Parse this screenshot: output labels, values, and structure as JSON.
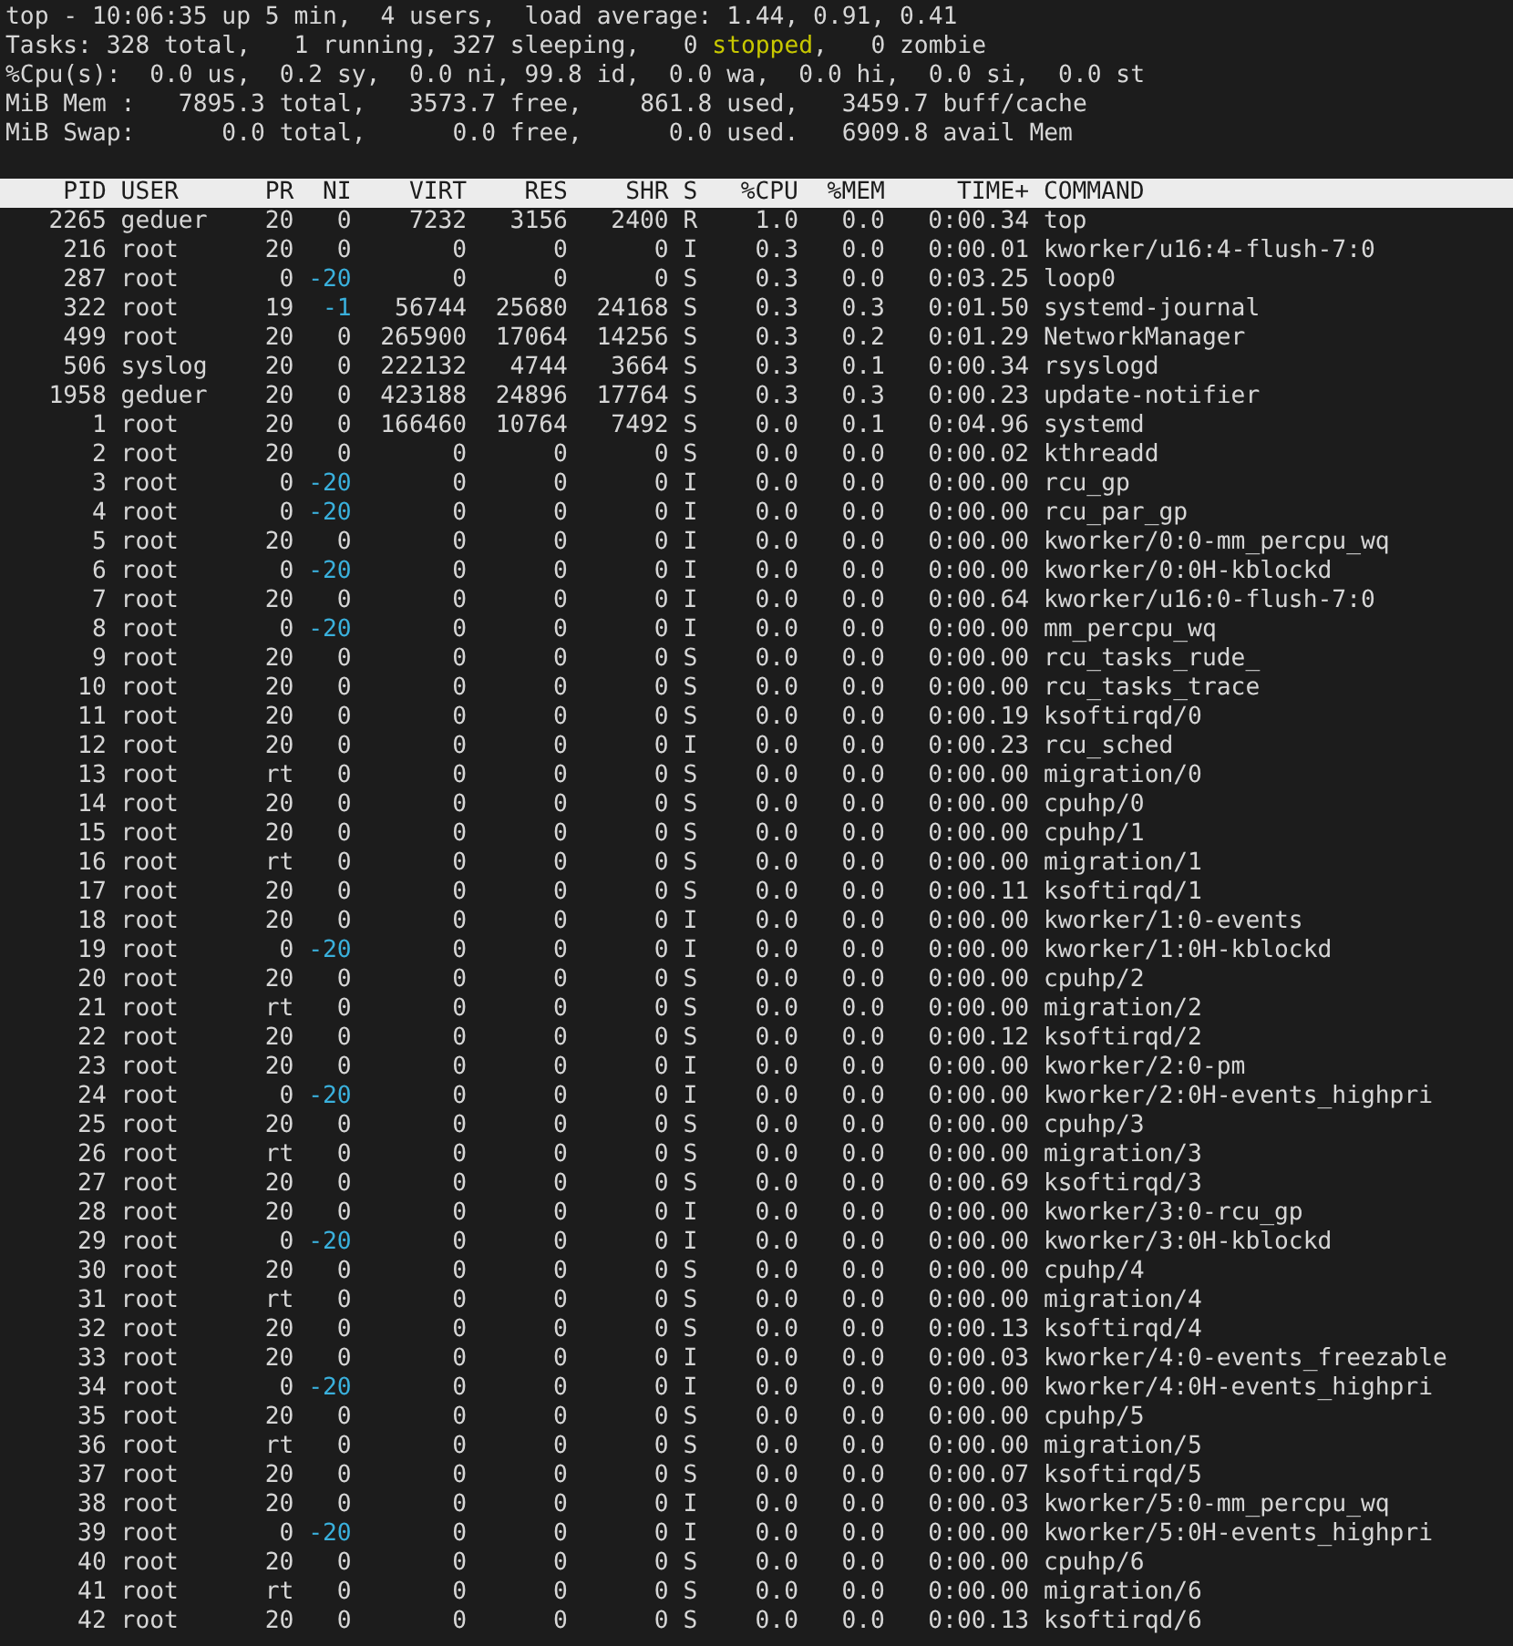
{
  "summary": [
    {
      "segments": [
        {
          "kind": "plain",
          "text": "top - 10:06:35 up 5 min,  4 users,  load average: 1.44, 0.91, 0.41"
        }
      ]
    },
    {
      "segments": [
        {
          "kind": "plain",
          "text": "Tasks: 328 total,   1 running, 327 sleeping,   0 "
        },
        {
          "kind": "highlight",
          "text": "stopped"
        },
        {
          "kind": "plain",
          "text": ",   0 zombie"
        }
      ]
    },
    {
      "segments": [
        {
          "kind": "plain",
          "text": "%Cpu(s):  0.0 us,  0.2 sy,  0.0 ni, 99.8 id,  0.0 wa,  0.0 hi,  0.0 si,  0.0 st"
        }
      ]
    },
    {
      "segments": [
        {
          "kind": "plain",
          "text": "MiB Mem :   7895.3 total,   3573.7 free,    861.8 used,   3459.7 buff/cache"
        }
      ]
    },
    {
      "segments": [
        {
          "kind": "plain",
          "text": "MiB Swap:      0.0 total,      0.0 free,      0.0 used.   6909.8 avail Mem"
        }
      ]
    }
  ],
  "columns": [
    "PID",
    "USER",
    "PR",
    "NI",
    "VIRT",
    "RES",
    "SHR",
    "S",
    "%CPU",
    "%MEM",
    "TIME+",
    "COMMAND"
  ],
  "rows": [
    {
      "pid": "2265",
      "user": "geduer",
      "pr": "20",
      "ni": "0",
      "virt": "7232",
      "res": "3156",
      "shr": "2400",
      "s": "R",
      "cpu": "1.0",
      "mem": "0.0",
      "time": "0:00.34",
      "command": "top",
      "ni_highlight": false
    },
    {
      "pid": "216",
      "user": "root",
      "pr": "20",
      "ni": "0",
      "virt": "0",
      "res": "0",
      "shr": "0",
      "s": "I",
      "cpu": "0.3",
      "mem": "0.0",
      "time": "0:00.01",
      "command": "kworker/u16:4-flush-7:0",
      "ni_highlight": false
    },
    {
      "pid": "287",
      "user": "root",
      "pr": "0",
      "ni": "-20",
      "virt": "0",
      "res": "0",
      "shr": "0",
      "s": "S",
      "cpu": "0.3",
      "mem": "0.0",
      "time": "0:03.25",
      "command": "loop0",
      "ni_highlight": true
    },
    {
      "pid": "322",
      "user": "root",
      "pr": "19",
      "ni": "-1",
      "virt": "56744",
      "res": "25680",
      "shr": "24168",
      "s": "S",
      "cpu": "0.3",
      "mem": "0.3",
      "time": "0:01.50",
      "command": "systemd-journal",
      "ni_highlight": true
    },
    {
      "pid": "499",
      "user": "root",
      "pr": "20",
      "ni": "0",
      "virt": "265900",
      "res": "17064",
      "shr": "14256",
      "s": "S",
      "cpu": "0.3",
      "mem": "0.2",
      "time": "0:01.29",
      "command": "NetworkManager",
      "ni_highlight": false
    },
    {
      "pid": "506",
      "user": "syslog",
      "pr": "20",
      "ni": "0",
      "virt": "222132",
      "res": "4744",
      "shr": "3664",
      "s": "S",
      "cpu": "0.3",
      "mem": "0.1",
      "time": "0:00.34",
      "command": "rsyslogd",
      "ni_highlight": false
    },
    {
      "pid": "1958",
      "user": "geduer",
      "pr": "20",
      "ni": "0",
      "virt": "423188",
      "res": "24896",
      "shr": "17764",
      "s": "S",
      "cpu": "0.3",
      "mem": "0.3",
      "time": "0:00.23",
      "command": "update-notifier",
      "ni_highlight": false
    },
    {
      "pid": "1",
      "user": "root",
      "pr": "20",
      "ni": "0",
      "virt": "166460",
      "res": "10764",
      "shr": "7492",
      "s": "S",
      "cpu": "0.0",
      "mem": "0.1",
      "time": "0:04.96",
      "command": "systemd",
      "ni_highlight": false
    },
    {
      "pid": "2",
      "user": "root",
      "pr": "20",
      "ni": "0",
      "virt": "0",
      "res": "0",
      "shr": "0",
      "s": "S",
      "cpu": "0.0",
      "mem": "0.0",
      "time": "0:00.02",
      "command": "kthreadd",
      "ni_highlight": false
    },
    {
      "pid": "3",
      "user": "root",
      "pr": "0",
      "ni": "-20",
      "virt": "0",
      "res": "0",
      "shr": "0",
      "s": "I",
      "cpu": "0.0",
      "mem": "0.0",
      "time": "0:00.00",
      "command": "rcu_gp",
      "ni_highlight": true
    },
    {
      "pid": "4",
      "user": "root",
      "pr": "0",
      "ni": "-20",
      "virt": "0",
      "res": "0",
      "shr": "0",
      "s": "I",
      "cpu": "0.0",
      "mem": "0.0",
      "time": "0:00.00",
      "command": "rcu_par_gp",
      "ni_highlight": true
    },
    {
      "pid": "5",
      "user": "root",
      "pr": "20",
      "ni": "0",
      "virt": "0",
      "res": "0",
      "shr": "0",
      "s": "I",
      "cpu": "0.0",
      "mem": "0.0",
      "time": "0:00.00",
      "command": "kworker/0:0-mm_percpu_wq",
      "ni_highlight": false
    },
    {
      "pid": "6",
      "user": "root",
      "pr": "0",
      "ni": "-20",
      "virt": "0",
      "res": "0",
      "shr": "0",
      "s": "I",
      "cpu": "0.0",
      "mem": "0.0",
      "time": "0:00.00",
      "command": "kworker/0:0H-kblockd",
      "ni_highlight": true
    },
    {
      "pid": "7",
      "user": "root",
      "pr": "20",
      "ni": "0",
      "virt": "0",
      "res": "0",
      "shr": "0",
      "s": "I",
      "cpu": "0.0",
      "mem": "0.0",
      "time": "0:00.64",
      "command": "kworker/u16:0-flush-7:0",
      "ni_highlight": false
    },
    {
      "pid": "8",
      "user": "root",
      "pr": "0",
      "ni": "-20",
      "virt": "0",
      "res": "0",
      "shr": "0",
      "s": "I",
      "cpu": "0.0",
      "mem": "0.0",
      "time": "0:00.00",
      "command": "mm_percpu_wq",
      "ni_highlight": true
    },
    {
      "pid": "9",
      "user": "root",
      "pr": "20",
      "ni": "0",
      "virt": "0",
      "res": "0",
      "shr": "0",
      "s": "S",
      "cpu": "0.0",
      "mem": "0.0",
      "time": "0:00.00",
      "command": "rcu_tasks_rude_",
      "ni_highlight": false
    },
    {
      "pid": "10",
      "user": "root",
      "pr": "20",
      "ni": "0",
      "virt": "0",
      "res": "0",
      "shr": "0",
      "s": "S",
      "cpu": "0.0",
      "mem": "0.0",
      "time": "0:00.00",
      "command": "rcu_tasks_trace",
      "ni_highlight": false
    },
    {
      "pid": "11",
      "user": "root",
      "pr": "20",
      "ni": "0",
      "virt": "0",
      "res": "0",
      "shr": "0",
      "s": "S",
      "cpu": "0.0",
      "mem": "0.0",
      "time": "0:00.19",
      "command": "ksoftirqd/0",
      "ni_highlight": false
    },
    {
      "pid": "12",
      "user": "root",
      "pr": "20",
      "ni": "0",
      "virt": "0",
      "res": "0",
      "shr": "0",
      "s": "I",
      "cpu": "0.0",
      "mem": "0.0",
      "time": "0:00.23",
      "command": "rcu_sched",
      "ni_highlight": false
    },
    {
      "pid": "13",
      "user": "root",
      "pr": "rt",
      "ni": "0",
      "virt": "0",
      "res": "0",
      "shr": "0",
      "s": "S",
      "cpu": "0.0",
      "mem": "0.0",
      "time": "0:00.00",
      "command": "migration/0",
      "ni_highlight": false
    },
    {
      "pid": "14",
      "user": "root",
      "pr": "20",
      "ni": "0",
      "virt": "0",
      "res": "0",
      "shr": "0",
      "s": "S",
      "cpu": "0.0",
      "mem": "0.0",
      "time": "0:00.00",
      "command": "cpuhp/0",
      "ni_highlight": false
    },
    {
      "pid": "15",
      "user": "root",
      "pr": "20",
      "ni": "0",
      "virt": "0",
      "res": "0",
      "shr": "0",
      "s": "S",
      "cpu": "0.0",
      "mem": "0.0",
      "time": "0:00.00",
      "command": "cpuhp/1",
      "ni_highlight": false
    },
    {
      "pid": "16",
      "user": "root",
      "pr": "rt",
      "ni": "0",
      "virt": "0",
      "res": "0",
      "shr": "0",
      "s": "S",
      "cpu": "0.0",
      "mem": "0.0",
      "time": "0:00.00",
      "command": "migration/1",
      "ni_highlight": false
    },
    {
      "pid": "17",
      "user": "root",
      "pr": "20",
      "ni": "0",
      "virt": "0",
      "res": "0",
      "shr": "0",
      "s": "S",
      "cpu": "0.0",
      "mem": "0.0",
      "time": "0:00.11",
      "command": "ksoftirqd/1",
      "ni_highlight": false
    },
    {
      "pid": "18",
      "user": "root",
      "pr": "20",
      "ni": "0",
      "virt": "0",
      "res": "0",
      "shr": "0",
      "s": "I",
      "cpu": "0.0",
      "mem": "0.0",
      "time": "0:00.00",
      "command": "kworker/1:0-events",
      "ni_highlight": false
    },
    {
      "pid": "19",
      "user": "root",
      "pr": "0",
      "ni": "-20",
      "virt": "0",
      "res": "0",
      "shr": "0",
      "s": "I",
      "cpu": "0.0",
      "mem": "0.0",
      "time": "0:00.00",
      "command": "kworker/1:0H-kblockd",
      "ni_highlight": true
    },
    {
      "pid": "20",
      "user": "root",
      "pr": "20",
      "ni": "0",
      "virt": "0",
      "res": "0",
      "shr": "0",
      "s": "S",
      "cpu": "0.0",
      "mem": "0.0",
      "time": "0:00.00",
      "command": "cpuhp/2",
      "ni_highlight": false
    },
    {
      "pid": "21",
      "user": "root",
      "pr": "rt",
      "ni": "0",
      "virt": "0",
      "res": "0",
      "shr": "0",
      "s": "S",
      "cpu": "0.0",
      "mem": "0.0",
      "time": "0:00.00",
      "command": "migration/2",
      "ni_highlight": false
    },
    {
      "pid": "22",
      "user": "root",
      "pr": "20",
      "ni": "0",
      "virt": "0",
      "res": "0",
      "shr": "0",
      "s": "S",
      "cpu": "0.0",
      "mem": "0.0",
      "time": "0:00.12",
      "command": "ksoftirqd/2",
      "ni_highlight": false
    },
    {
      "pid": "23",
      "user": "root",
      "pr": "20",
      "ni": "0",
      "virt": "0",
      "res": "0",
      "shr": "0",
      "s": "I",
      "cpu": "0.0",
      "mem": "0.0",
      "time": "0:00.00",
      "command": "kworker/2:0-pm",
      "ni_highlight": false
    },
    {
      "pid": "24",
      "user": "root",
      "pr": "0",
      "ni": "-20",
      "virt": "0",
      "res": "0",
      "shr": "0",
      "s": "I",
      "cpu": "0.0",
      "mem": "0.0",
      "time": "0:00.00",
      "command": "kworker/2:0H-events_highpri",
      "ni_highlight": true
    },
    {
      "pid": "25",
      "user": "root",
      "pr": "20",
      "ni": "0",
      "virt": "0",
      "res": "0",
      "shr": "0",
      "s": "S",
      "cpu": "0.0",
      "mem": "0.0",
      "time": "0:00.00",
      "command": "cpuhp/3",
      "ni_highlight": false
    },
    {
      "pid": "26",
      "user": "root",
      "pr": "rt",
      "ni": "0",
      "virt": "0",
      "res": "0",
      "shr": "0",
      "s": "S",
      "cpu": "0.0",
      "mem": "0.0",
      "time": "0:00.00",
      "command": "migration/3",
      "ni_highlight": false
    },
    {
      "pid": "27",
      "user": "root",
      "pr": "20",
      "ni": "0",
      "virt": "0",
      "res": "0",
      "shr": "0",
      "s": "S",
      "cpu": "0.0",
      "mem": "0.0",
      "time": "0:00.69",
      "command": "ksoftirqd/3",
      "ni_highlight": false
    },
    {
      "pid": "28",
      "user": "root",
      "pr": "20",
      "ni": "0",
      "virt": "0",
      "res": "0",
      "shr": "0",
      "s": "I",
      "cpu": "0.0",
      "mem": "0.0",
      "time": "0:00.00",
      "command": "kworker/3:0-rcu_gp",
      "ni_highlight": false
    },
    {
      "pid": "29",
      "user": "root",
      "pr": "0",
      "ni": "-20",
      "virt": "0",
      "res": "0",
      "shr": "0",
      "s": "I",
      "cpu": "0.0",
      "mem": "0.0",
      "time": "0:00.00",
      "command": "kworker/3:0H-kblockd",
      "ni_highlight": true
    },
    {
      "pid": "30",
      "user": "root",
      "pr": "20",
      "ni": "0",
      "virt": "0",
      "res": "0",
      "shr": "0",
      "s": "S",
      "cpu": "0.0",
      "mem": "0.0",
      "time": "0:00.00",
      "command": "cpuhp/4",
      "ni_highlight": false
    },
    {
      "pid": "31",
      "user": "root",
      "pr": "rt",
      "ni": "0",
      "virt": "0",
      "res": "0",
      "shr": "0",
      "s": "S",
      "cpu": "0.0",
      "mem": "0.0",
      "time": "0:00.00",
      "command": "migration/4",
      "ni_highlight": false
    },
    {
      "pid": "32",
      "user": "root",
      "pr": "20",
      "ni": "0",
      "virt": "0",
      "res": "0",
      "shr": "0",
      "s": "S",
      "cpu": "0.0",
      "mem": "0.0",
      "time": "0:00.13",
      "command": "ksoftirqd/4",
      "ni_highlight": false
    },
    {
      "pid": "33",
      "user": "root",
      "pr": "20",
      "ni": "0",
      "virt": "0",
      "res": "0",
      "shr": "0",
      "s": "I",
      "cpu": "0.0",
      "mem": "0.0",
      "time": "0:00.03",
      "command": "kworker/4:0-events_freezable",
      "ni_highlight": false
    },
    {
      "pid": "34",
      "user": "root",
      "pr": "0",
      "ni": "-20",
      "virt": "0",
      "res": "0",
      "shr": "0",
      "s": "I",
      "cpu": "0.0",
      "mem": "0.0",
      "time": "0:00.00",
      "command": "kworker/4:0H-events_highpri",
      "ni_highlight": true
    },
    {
      "pid": "35",
      "user": "root",
      "pr": "20",
      "ni": "0",
      "virt": "0",
      "res": "0",
      "shr": "0",
      "s": "S",
      "cpu": "0.0",
      "mem": "0.0",
      "time": "0:00.00",
      "command": "cpuhp/5",
      "ni_highlight": false
    },
    {
      "pid": "36",
      "user": "root",
      "pr": "rt",
      "ni": "0",
      "virt": "0",
      "res": "0",
      "shr": "0",
      "s": "S",
      "cpu": "0.0",
      "mem": "0.0",
      "time": "0:00.00",
      "command": "migration/5",
      "ni_highlight": false
    },
    {
      "pid": "37",
      "user": "root",
      "pr": "20",
      "ni": "0",
      "virt": "0",
      "res": "0",
      "shr": "0",
      "s": "S",
      "cpu": "0.0",
      "mem": "0.0",
      "time": "0:00.07",
      "command": "ksoftirqd/5",
      "ni_highlight": false
    },
    {
      "pid": "38",
      "user": "root",
      "pr": "20",
      "ni": "0",
      "virt": "0",
      "res": "0",
      "shr": "0",
      "s": "I",
      "cpu": "0.0",
      "mem": "0.0",
      "time": "0:00.03",
      "command": "kworker/5:0-mm_percpu_wq",
      "ni_highlight": false
    },
    {
      "pid": "39",
      "user": "root",
      "pr": "0",
      "ni": "-20",
      "virt": "0",
      "res": "0",
      "shr": "0",
      "s": "I",
      "cpu": "0.0",
      "mem": "0.0",
      "time": "0:00.00",
      "command": "kworker/5:0H-events_highpri",
      "ni_highlight": true
    },
    {
      "pid": "40",
      "user": "root",
      "pr": "20",
      "ni": "0",
      "virt": "0",
      "res": "0",
      "shr": "0",
      "s": "S",
      "cpu": "0.0",
      "mem": "0.0",
      "time": "0:00.00",
      "command": "cpuhp/6",
      "ni_highlight": false
    },
    {
      "pid": "41",
      "user": "root",
      "pr": "rt",
      "ni": "0",
      "virt": "0",
      "res": "0",
      "shr": "0",
      "s": "S",
      "cpu": "0.0",
      "mem": "0.0",
      "time": "0:00.00",
      "command": "migration/6",
      "ni_highlight": false
    },
    {
      "pid": "42",
      "user": "root",
      "pr": "20",
      "ni": "0",
      "virt": "0",
      "res": "0",
      "shr": "0",
      "s": "S",
      "cpu": "0.0",
      "mem": "0.0",
      "time": "0:00.13",
      "command": "ksoftirqd/6",
      "ni_highlight": false
    }
  ]
}
